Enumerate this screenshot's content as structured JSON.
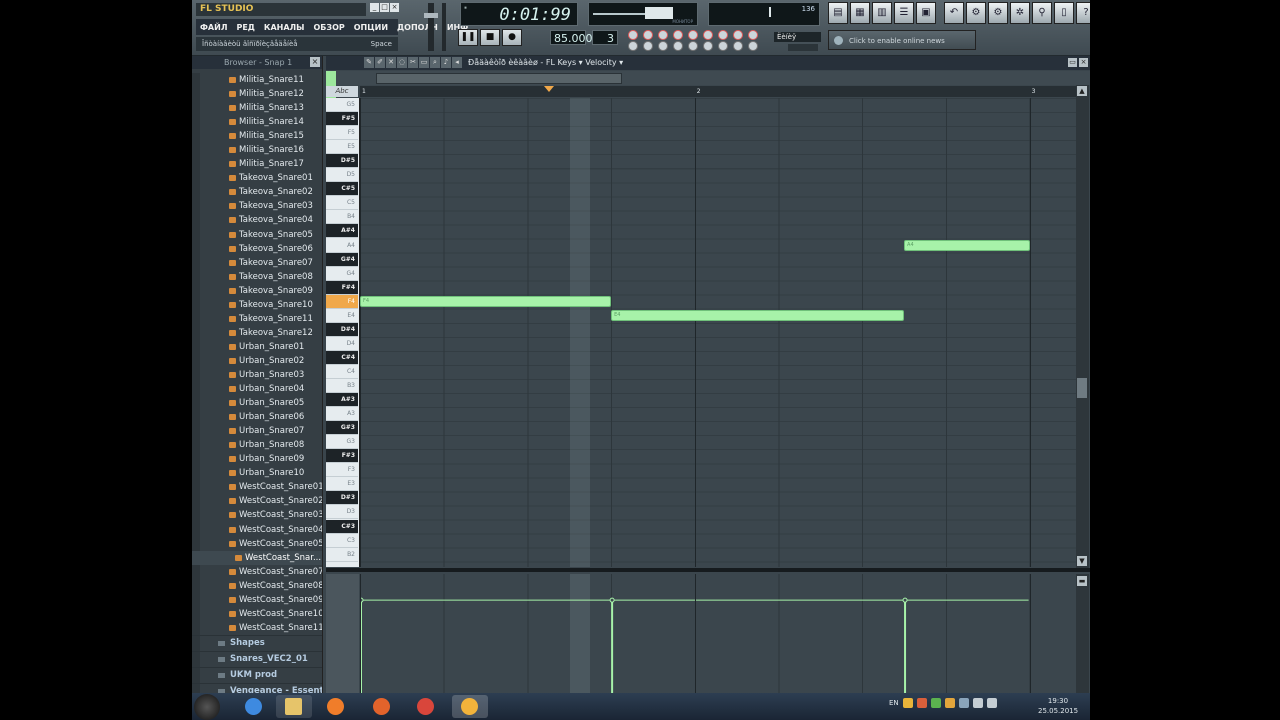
{
  "app": {
    "logo": "FL STUDIO",
    "menu": [
      "ФАЙЛ",
      "РЕД",
      "КАНАЛЫ",
      "ОБЗОР",
      "ОПЦИИ",
      "ДОПОЛН",
      "ИНФ"
    ],
    "hint_text": "Îñòàíàâèòü âîñïðîèçâåäåíèå",
    "hint_key": "Space",
    "time": "0:01:99",
    "monitor_label": "МОНИТОР",
    "cpu": "136",
    "tempo": "85.000",
    "pattern": "3",
    "small_label": "Ëèíèÿ",
    "news": "Click to enable online news"
  },
  "browser": {
    "header": "Browser - Snap 1",
    "items": [
      "Militia_Snare11",
      "Militia_Snare12",
      "Militia_Snare13",
      "Militia_Snare14",
      "Militia_Snare15",
      "Militia_Snare16",
      "Militia_Snare17",
      "Takeova_Snare01",
      "Takeova_Snare02",
      "Takeova_Snare03",
      "Takeova_Snare04",
      "Takeova_Snare05",
      "Takeova_Snare06",
      "Takeova_Snare07",
      "Takeova_Snare08",
      "Takeova_Snare09",
      "Takeova_Snare10",
      "Takeova_Snare11",
      "Takeova_Snare12",
      "Urban_Snare01",
      "Urban_Snare02",
      "Urban_Snare03",
      "Urban_Snare04",
      "Urban_Snare05",
      "Urban_Snare06",
      "Urban_Snare07",
      "Urban_Snare08",
      "Urban_Snare09",
      "Urban_Snare10",
      "WestCoast_Snare01",
      "WestCoast_Snare02",
      "WestCoast_Snare03",
      "WestCoast_Snare04",
      "WestCoast_Snare05",
      "WestCoast_Snar...",
      "WestCoast_Snare07",
      "WestCoast_Snare08",
      "WestCoast_Snare09",
      "WestCoast_Snare10",
      "WestCoast_Snare11"
    ],
    "selected_index": 34,
    "folders": [
      "Shapes",
      "Snares_VEC2_01",
      "UKM prod",
      "Vengeance - Essenti..."
    ]
  },
  "piano_roll": {
    "title": "Ðåäàêòîð èêàâèø",
    "instrument": "FL Keys",
    "target": "Velocity",
    "abc": "Abc",
    "bars": [
      "1",
      "2",
      "3"
    ],
    "keys": [
      "G5",
      "F#5",
      "F5",
      "E5",
      "D#5",
      "D5",
      "C#5",
      "C5",
      "B4",
      "A#4",
      "A4",
      "G#4",
      "G4",
      "F#4",
      "F4",
      "E4",
      "D#4",
      "D4",
      "C#4",
      "C4",
      "B3",
      "A#3",
      "A3",
      "G#3",
      "G3",
      "F#3",
      "F3",
      "E3",
      "D#3",
      "D3",
      "C#3",
      "C3",
      "B2"
    ],
    "active_key": "F4",
    "notes": [
      {
        "key": "F4",
        "start": 0,
        "length": 3,
        "label": "F4"
      },
      {
        "key": "E4",
        "start": 3,
        "length": 3.5,
        "label": "E4"
      },
      {
        "key": "A4",
        "start": 6.5,
        "length": 1.5,
        "label": "A4"
      }
    ],
    "velocity_level": 0.78
  },
  "taskbar": {
    "lang": "EN",
    "time": "19:30",
    "date": "25.05.2015"
  }
}
